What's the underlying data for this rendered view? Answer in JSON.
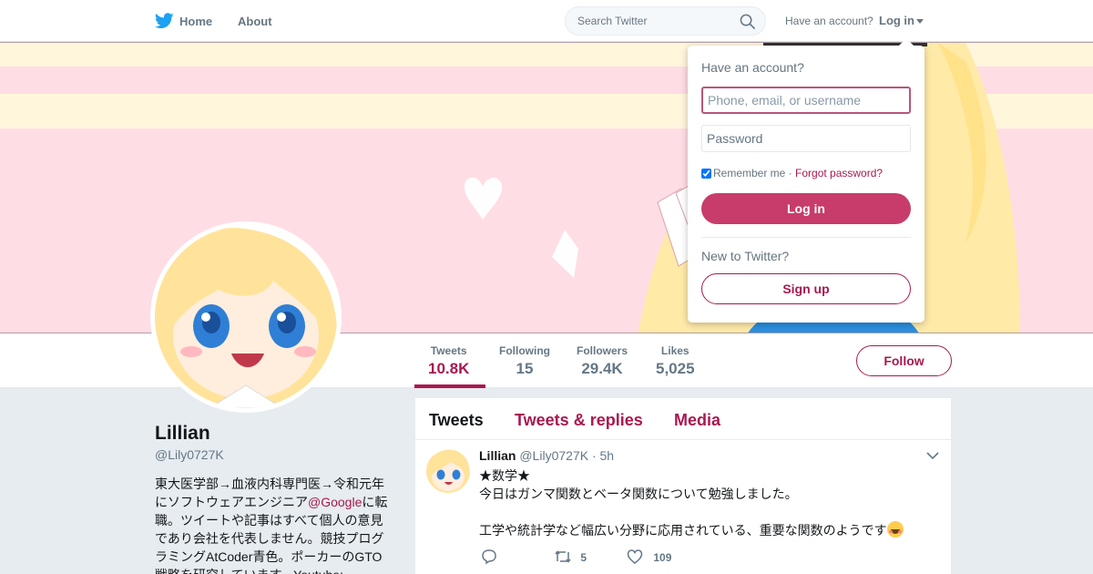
{
  "nav": {
    "home_label": "Home",
    "about_label": "About",
    "search_placeholder": "Search Twitter",
    "have_account": "Have an account?",
    "login_label": "Log in"
  },
  "profile": {
    "name": "Lillian",
    "handle": "@Lily0727K",
    "bio_part1": "東大医学部→血液内科専門医→令和元年にソフトウェアエンジニア",
    "bio_link": "@Google",
    "bio_part2": "に転職。ツイートや記事はすべて個人の意見であり会社を代表しません。競技プログラミングAtCoder青色。ポーカーのGTO戦略を研究しています。Youtube:",
    "stats": [
      {
        "label": "Tweets",
        "value": "10.8K"
      },
      {
        "label": "Following",
        "value": "15"
      },
      {
        "label": "Followers",
        "value": "29.4K"
      },
      {
        "label": "Likes",
        "value": "5,025"
      }
    ],
    "follow_label": "Follow"
  },
  "timeline": {
    "tabs": [
      "Tweets",
      "Tweets & replies",
      "Media"
    ],
    "tweet": {
      "name": "Lillian",
      "handle": "@Lily0727K",
      "time": "· 5h",
      "line1": "★数学★",
      "line2": "今日はガンマ関数とベータ関数について勉強しました。",
      "line3": "",
      "line4": "工学や統計学など幅広い分野に応用されている、重要な関数のようです",
      "emoji": "smiling-face-icon",
      "retweets": "5",
      "likes": "109"
    }
  },
  "login_dropdown": {
    "title": "Have an account?",
    "username_placeholder": "Phone, email, or username",
    "password_placeholder": "Password",
    "remember_label": "Remember me",
    "separator": " · ",
    "forgot_label": "Forgot password?",
    "login_button": "Log in",
    "new_label": "New to Twitter?",
    "signup_button": "Sign up"
  },
  "colors": {
    "accent": "#a91850",
    "login_button": "#c73c6a",
    "banner_pink": "#ffdde5",
    "banner_cream": "#fff6dc",
    "twitter_blue": "#1da1f2"
  }
}
